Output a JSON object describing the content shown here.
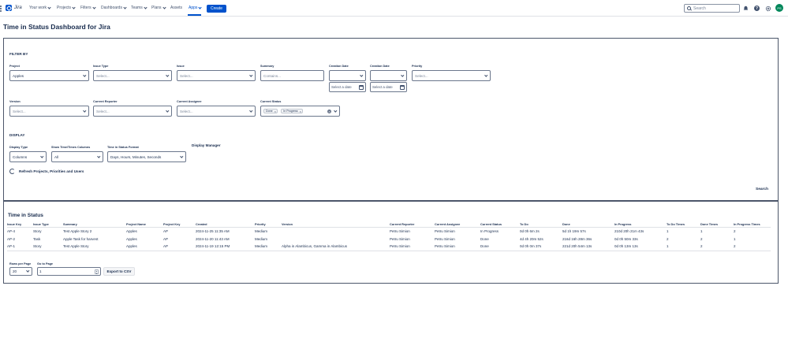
{
  "nav": {
    "logo_text": "Jira",
    "items": [
      "Your work",
      "Projects",
      "Filters",
      "Dashboards",
      "Teams",
      "Plans",
      "Assets",
      "Apps"
    ],
    "create_label": "Create",
    "search_placeholder": "Search",
    "avatar_initials": "PS",
    "accent_color": "#0052cc"
  },
  "page": {
    "title": "Time in Status Dashboard for Jira"
  },
  "filters": {
    "section_title": "FILTER BY",
    "project": {
      "label": "Project",
      "value": "Apples"
    },
    "issue_type": {
      "label": "Issue Type",
      "placeholder": "Select..."
    },
    "issue": {
      "label": "Issue",
      "placeholder": "Select..."
    },
    "summary": {
      "label": "Summary",
      "placeholder": "Contains..."
    },
    "creation_date_from": {
      "label": "Creation Date",
      "placeholder": "Select a date"
    },
    "creation_date_to": {
      "label": "Creation Date",
      "placeholder": "Select a date"
    },
    "priority": {
      "label": "Priority",
      "placeholder": "Select..."
    },
    "version": {
      "label": "Version",
      "placeholder": "Select..."
    },
    "current_reporter": {
      "label": "Current Reporter",
      "placeholder": "Select..."
    },
    "current_assignee": {
      "label": "Current Assignee",
      "placeholder": "Select..."
    },
    "current_status": {
      "label": "Current Status",
      "tags": [
        "Done",
        "In Progress"
      ]
    }
  },
  "display": {
    "section_title": "DISPLAY",
    "display_type": {
      "label": "Display Type",
      "value": "Columns"
    },
    "show_columns": {
      "label": "Show Time/Times Columns",
      "value": "All"
    },
    "format": {
      "label": "Time in Status Format",
      "value": "Days, Hours, Minutes, Seconds"
    },
    "display_manager_label": "Display Manager",
    "refresh_label": "Refresh Projects, Priorities and Users",
    "search_label": "Search"
  },
  "results": {
    "title": "Time in Status",
    "columns": [
      "Issue Key",
      "Issue Type",
      "Summary",
      "Project Name",
      "Project Key",
      "Created",
      "Priority",
      "Version",
      "Current Reporter",
      "Current Assignee",
      "Current Status",
      "To Do",
      "Done",
      "In Progress",
      "To Do Times",
      "Done Times",
      "In Progress Times"
    ],
    "rows": [
      [
        "AP-4",
        "Story",
        "Test Apple Story 2",
        "Apples",
        "AP",
        "2024-11-25 11:35 AM",
        "Medium",
        "",
        "Petru Simion",
        "Petru Simion",
        "In Progress",
        "0d 0h 6m 2s",
        "5d 1h 19m 57s",
        "210d 20h 21m 43s",
        "1",
        "1",
        "2"
      ],
      [
        "AP-2",
        "Task",
        "Apple Task for harvest",
        "Apples",
        "AP",
        "2024-11-20 11:43 AM",
        "Medium",
        "",
        "Petru Simion",
        "Petru Simion",
        "Done",
        "4d 4h 20m 52s",
        "216d 16h 28m 36s",
        "0d 0h 50m 33s",
        "2",
        "2",
        "1"
      ],
      [
        "AP-1",
        "Story",
        "Test Apple Story",
        "Apples",
        "AP",
        "2024-11-19 12:15 PM",
        "Medium",
        "Alpha in Alambicus, Gamma in Alambicus",
        "Petru Simion",
        "Petru Simion",
        "Done",
        "0d 0h 0m 37s",
        "221d 20h 54m 13s",
        "0d 0h 13m 13s",
        "1",
        "2",
        "2"
      ]
    ],
    "rows_per_page": {
      "label": "Rows per Page",
      "value": "20"
    },
    "go_to_page": {
      "label": "Go to Page",
      "value": "1"
    },
    "export_label": "Export to CSV"
  }
}
